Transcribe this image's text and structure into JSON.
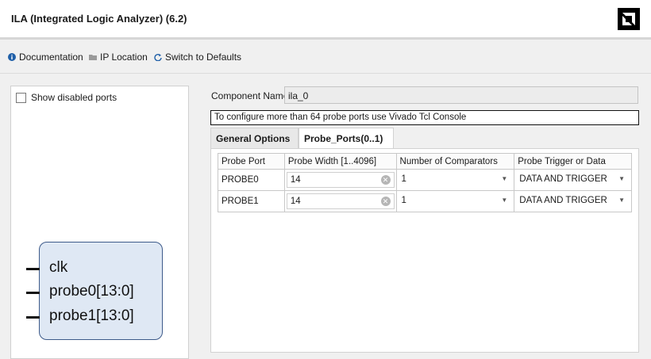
{
  "header": {
    "title": "ILA (Integrated Logic Analyzer) (6.2)",
    "logo_icon": "amd-logo-icon"
  },
  "toolbar": {
    "documentation": "Documentation",
    "ip_location": "IP Location",
    "switch_defaults": "Switch to Defaults"
  },
  "left_panel": {
    "show_disabled_ports": "Show disabled ports",
    "ports": [
      "clk",
      "probe0[13:0]",
      "probe1[13:0]"
    ]
  },
  "component": {
    "label": "Component Name",
    "value": "ila_0"
  },
  "notice": "To configure more than 64 probe ports use Vivado Tcl Console",
  "tabs": [
    "General Options",
    "Probe_Ports(0..1)"
  ],
  "table": {
    "headers": [
      "Probe Port",
      "Probe Width [1..4096]",
      "Number of Comparators",
      "Probe Trigger or Data"
    ],
    "rows": [
      {
        "port": "PROBE0",
        "width": "14",
        "comparators": "1",
        "trigger": "DATA AND TRIGGER"
      },
      {
        "port": "PROBE1",
        "width": "14",
        "comparators": "1",
        "trigger": "DATA AND TRIGGER"
      }
    ]
  },
  "colors": {
    "block_fill": "#dfe8f4",
    "block_border": "#3d5a8a",
    "info_blue": "#1f5fa8"
  }
}
